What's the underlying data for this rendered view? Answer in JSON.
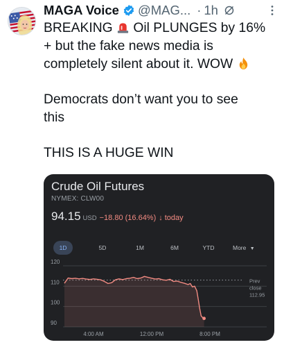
{
  "tweet": {
    "author_name": "MAGA Voice",
    "handle": "@MAG...",
    "separator": "·",
    "time": "1h",
    "lines": {
      "l1_a": "BREAKING",
      "l1_b": "Oil PLUNGES by 16%",
      "l2": "+ but the fake news media is",
      "l3_a": "completely silent about it. WOW",
      "p2_l1": "Democrats don’t want you to see",
      "p2_l2": "this",
      "p3": "THIS IS A HUGE WIN"
    }
  },
  "card": {
    "title": "Crude Oil Futures",
    "subtitle": "NYMEX: CLW00",
    "price": "94.15",
    "currency": "USD",
    "change": "−18.80 (16.64%)",
    "down_arrow": "↓",
    "period": "today",
    "ranges": [
      "1D",
      "5D",
      "1M",
      "6M",
      "YTD",
      "More"
    ],
    "active_range": "1D"
  },
  "chart_data": {
    "type": "line",
    "y_ticks": [
      "120",
      "110",
      "100",
      "90"
    ],
    "ylim": [
      90,
      120
    ],
    "x_tick_labels": [
      "4:00 AM",
      "12:00 PM",
      "8:00 PM"
    ],
    "x_ticks": [
      4,
      12,
      20
    ],
    "xlim": [
      0,
      24
    ],
    "prev_close": {
      "label_lines": [
        "Prev",
        "close",
        "112.95"
      ],
      "value": 112.95
    },
    "series": [
      {
        "x": [
          0,
          0.5,
          1,
          1.5,
          2,
          2.5,
          3,
          3.5,
          4,
          4.5,
          5,
          5.5,
          6,
          6.5,
          7,
          7.5,
          8,
          8.5,
          9,
          9.5,
          10,
          10.5,
          11,
          11.5,
          12,
          12.5,
          13,
          13.5,
          14,
          14.5,
          15,
          15.5,
          16,
          16.5,
          17,
          17.3,
          17.6,
          17.9,
          18.2,
          18.4,
          18.6,
          18.8,
          19.0,
          19.2
        ],
        "y": [
          111.4,
          114.0,
          113.7,
          113.9,
          113.6,
          113.8,
          113.5,
          113.3,
          113.6,
          113.4,
          113.1,
          112.3,
          111.3,
          111.7,
          113.1,
          113.6,
          113.2,
          113.7,
          113.9,
          114.3,
          113.7,
          114.0,
          114.8,
          114.3,
          113.9,
          113.5,
          113.7,
          113.1,
          112.9,
          113.4,
          112.3,
          112.5,
          111.9,
          111.4,
          110.8,
          111.3,
          109.6,
          110.0,
          107.8,
          103.5,
          99.0,
          95.4,
          94.6,
          94.15
        ],
        "color": "#f28b82"
      }
    ],
    "grid": true
  }
}
